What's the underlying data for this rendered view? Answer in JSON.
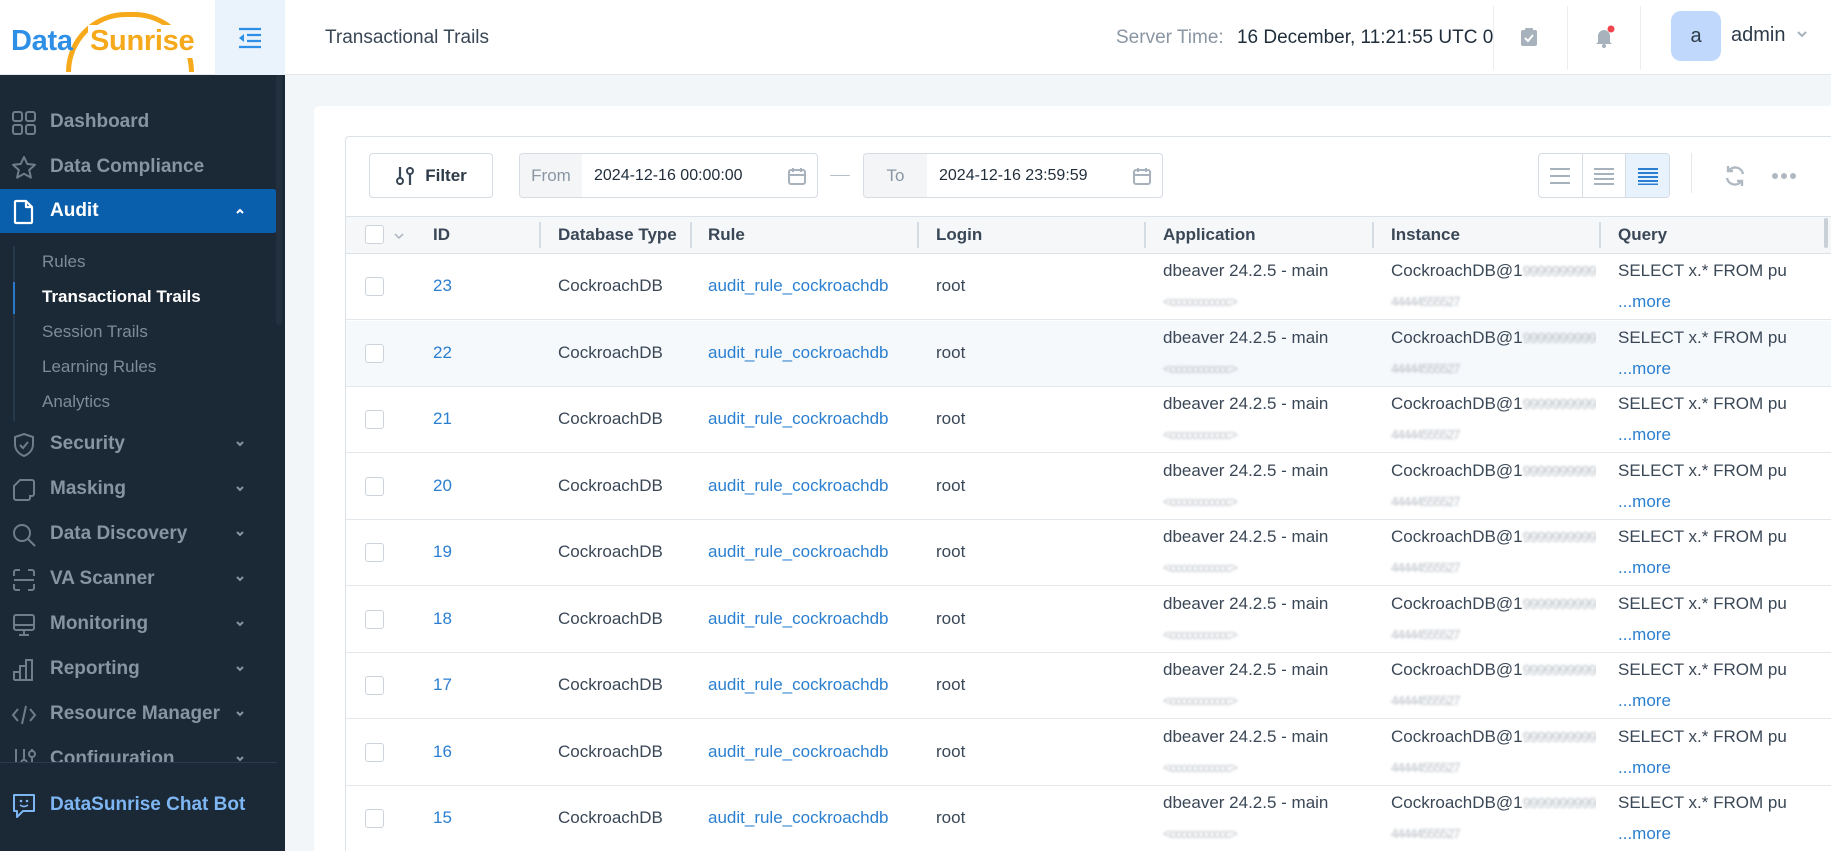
{
  "brand": {
    "part1": "Data",
    "part2": "Sunrise",
    "colors": {
      "blue": "#2d8fe6",
      "orange": "#f5a91b"
    }
  },
  "header": {
    "title": "Transactional Trails",
    "server_time_label": "Server Time:",
    "server_time_value": "16 December, 11:21:55  UTC 0",
    "icons": [
      "menu-collapse-icon",
      "task-check-icon",
      "bell-icon"
    ],
    "notification_dot": true,
    "user": {
      "avatar_letter": "a",
      "name": "admin"
    }
  },
  "sidebar": {
    "items": [
      {
        "label": "Dashboard",
        "icon": "grid-icon"
      },
      {
        "label": "Data Compliance",
        "icon": "star-icon"
      },
      {
        "label": "Audit",
        "icon": "document-icon",
        "active": true,
        "expanded": true
      },
      {
        "label": "Security",
        "icon": "shield-icon"
      },
      {
        "label": "Masking",
        "icon": "masking-icon"
      },
      {
        "label": "Data Discovery",
        "icon": "search-icon"
      },
      {
        "label": "VA Scanner",
        "icon": "scanner-icon"
      },
      {
        "label": "Monitoring",
        "icon": "monitor-icon"
      },
      {
        "label": "Reporting",
        "icon": "bar-chart-icon"
      },
      {
        "label": "Resource Manager",
        "icon": "code-icon"
      },
      {
        "label": "Configuration",
        "icon": "sliders-icon"
      }
    ],
    "audit_subitems": [
      {
        "label": "Rules"
      },
      {
        "label": "Transactional Trails",
        "active": true
      },
      {
        "label": "Session Trails"
      },
      {
        "label": "Learning Rules"
      },
      {
        "label": "Analytics"
      }
    ],
    "chatbot": {
      "label": "DataSunrise Chat Bot",
      "icon": "chat-bot-icon"
    },
    "active_color": "#0a5fad"
  },
  "toolbar": {
    "filter_label": "Filter",
    "from_label": "From",
    "from_value": "2024-12-16 00:00:00",
    "to_label": "To",
    "to_value": "2024-12-16 23:59:59",
    "view_modes": [
      "comfortable",
      "standard",
      "compact"
    ],
    "active_view_mode": "compact"
  },
  "table": {
    "columns": [
      "ID",
      "Database Type",
      "Rule",
      "Login",
      "Application",
      "Instance",
      "Query"
    ],
    "more_label": "...more",
    "rows": [
      {
        "id": "23",
        "db_type": "CockroachDB",
        "rule": "audit_rule_cockroachdb",
        "login": "root",
        "application": "dbeaver 24.2.5 - main",
        "application_sub": "<ccccccccccc>",
        "instance": "CockroachDB@1",
        "instance_masked": "999999999912",
        "instance_sub": "44444555527",
        "query": "SELECT x.* FROM pu"
      },
      {
        "id": "22",
        "db_type": "CockroachDB",
        "rule": "audit_rule_cockroachdb",
        "login": "root",
        "application": "dbeaver 24.2.5 - main",
        "application_sub": "<ccccccccccc>",
        "instance": "CockroachDB@1",
        "instance_masked": "999999999912",
        "instance_sub": "44444555527",
        "query": "SELECT x.* FROM pu"
      },
      {
        "id": "21",
        "db_type": "CockroachDB",
        "rule": "audit_rule_cockroachdb",
        "login": "root",
        "application": "dbeaver 24.2.5 - main",
        "application_sub": "<ccccccccccc>",
        "instance": "CockroachDB@1",
        "instance_masked": "999999999912",
        "instance_sub": "44444555527",
        "query": "SELECT x.* FROM pu"
      },
      {
        "id": "20",
        "db_type": "CockroachDB",
        "rule": "audit_rule_cockroachdb",
        "login": "root",
        "application": "dbeaver 24.2.5 - main",
        "application_sub": "<ccccccccccc>",
        "instance": "CockroachDB@1",
        "instance_masked": "999999999912",
        "instance_sub": "44444555527",
        "query": "SELECT x.* FROM pu"
      },
      {
        "id": "19",
        "db_type": "CockroachDB",
        "rule": "audit_rule_cockroachdb",
        "login": "root",
        "application": "dbeaver 24.2.5 - main",
        "application_sub": "<ccccccccccc>",
        "instance": "CockroachDB@1",
        "instance_masked": "999999999912",
        "instance_sub": "44444555527",
        "query": "SELECT x.* FROM pu"
      },
      {
        "id": "18",
        "db_type": "CockroachDB",
        "rule": "audit_rule_cockroachdb",
        "login": "root",
        "application": "dbeaver 24.2.5 - main",
        "application_sub": "<ccccccccccc>",
        "instance": "CockroachDB@1",
        "instance_masked": "999999999912",
        "instance_sub": "44444555527",
        "query": "SELECT x.* FROM pu"
      },
      {
        "id": "17",
        "db_type": "CockroachDB",
        "rule": "audit_rule_cockroachdb",
        "login": "root",
        "application": "dbeaver 24.2.5 - main",
        "application_sub": "<ccccccccccc>",
        "instance": "CockroachDB@1",
        "instance_masked": "999999999912",
        "instance_sub": "44444555527",
        "query": "SELECT x.* FROM pu"
      },
      {
        "id": "16",
        "db_type": "CockroachDB",
        "rule": "audit_rule_cockroachdb",
        "login": "root",
        "application": "dbeaver 24.2.5 - main",
        "application_sub": "<ccccccccccc>",
        "instance": "CockroachDB@1",
        "instance_masked": "999999999912",
        "instance_sub": "44444555527",
        "query": "SELECT x.* FROM pu"
      },
      {
        "id": "15",
        "db_type": "CockroachDB",
        "rule": "audit_rule_cockroachdb",
        "login": "root",
        "application": "dbeaver 24.2.5 - main",
        "application_sub": "<ccccccccccc>",
        "instance": "CockroachDB@1",
        "instance_masked": "999999999912",
        "instance_sub": "44444555527",
        "query": "SELECT x.* FROM pu"
      }
    ]
  }
}
